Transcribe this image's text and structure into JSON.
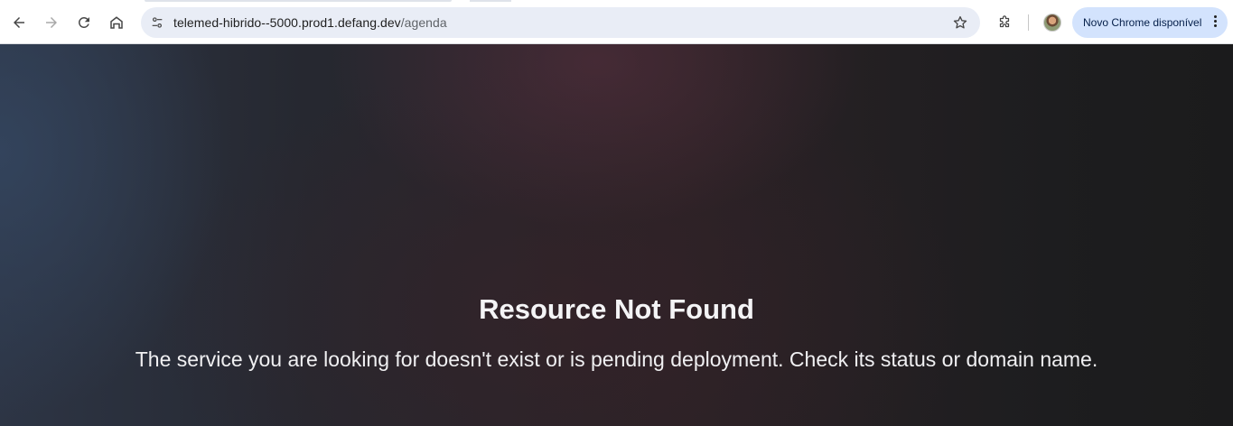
{
  "browser": {
    "url_host": "telemed-hibrido--5000.prod1.defang.dev",
    "url_path": "/agenda",
    "update_chip_label": "Novo Chrome disponível"
  },
  "icons": {
    "back": "arrow-left-icon",
    "forward": "arrow-right-icon",
    "reload": "reload-icon",
    "home": "home-icon",
    "site_info": "tune-icon",
    "bookmark": "star-icon",
    "extensions": "puzzle-icon",
    "menu": "kebab-menu-icon"
  },
  "page": {
    "title": "Resource Not Found",
    "message": "The service you are looking for doesn't exist or is pending deployment. Check its status or domain name."
  }
}
